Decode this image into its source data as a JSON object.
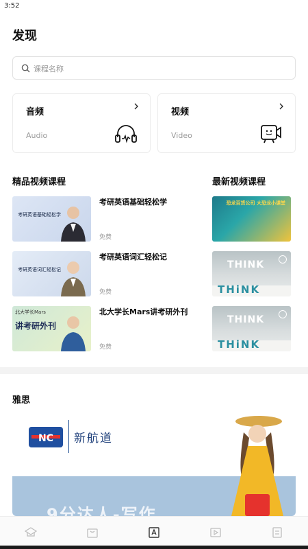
{
  "status": {
    "time": "3:52"
  },
  "page": {
    "title": "发现"
  },
  "search": {
    "placeholder": "课程名称"
  },
  "media_cards": [
    {
      "title": "音频",
      "subtitle": "Audio",
      "icon": "headphones-icon"
    },
    {
      "title": "视频",
      "subtitle": "Video",
      "icon": "video-player-icon"
    }
  ],
  "sections": {
    "featured_title": "精品视频课程",
    "latest_title": "最新视频课程",
    "ielts_title": "雅思"
  },
  "courses": [
    {
      "title": "考研英语基础轻松学",
      "price": "免费",
      "thumb_text": "考研英语基础轻松学"
    },
    {
      "title": "考研英语词汇轻松记",
      "price": "免费",
      "thumb_text": "考研英语词汇轻松记"
    },
    {
      "title": "北大学长Mars讲考研外刊",
      "price": "免费",
      "thumb_top": "北大学长Mars",
      "thumb_big": "讲考研外刊"
    }
  ],
  "latest_thumbs": {
    "n1_text": "恐龙百货公司 大恐龙小课堂",
    "think": "THINK",
    "think_big": "THiNK"
  },
  "banner": {
    "logo_text": "NC",
    "brand": "新航道",
    "headline": "9分达人-写作"
  },
  "tabbar": [
    {
      "icon": "home-hat-icon"
    },
    {
      "icon": "shopping-bag-icon"
    },
    {
      "icon": "book-discover-icon",
      "active": true
    },
    {
      "icon": "video-list-icon"
    },
    {
      "icon": "profile-card-icon"
    }
  ],
  "colors": {
    "accent": "#1e3f7a",
    "muted": "#999999",
    "divider": "#f3f3f3"
  }
}
